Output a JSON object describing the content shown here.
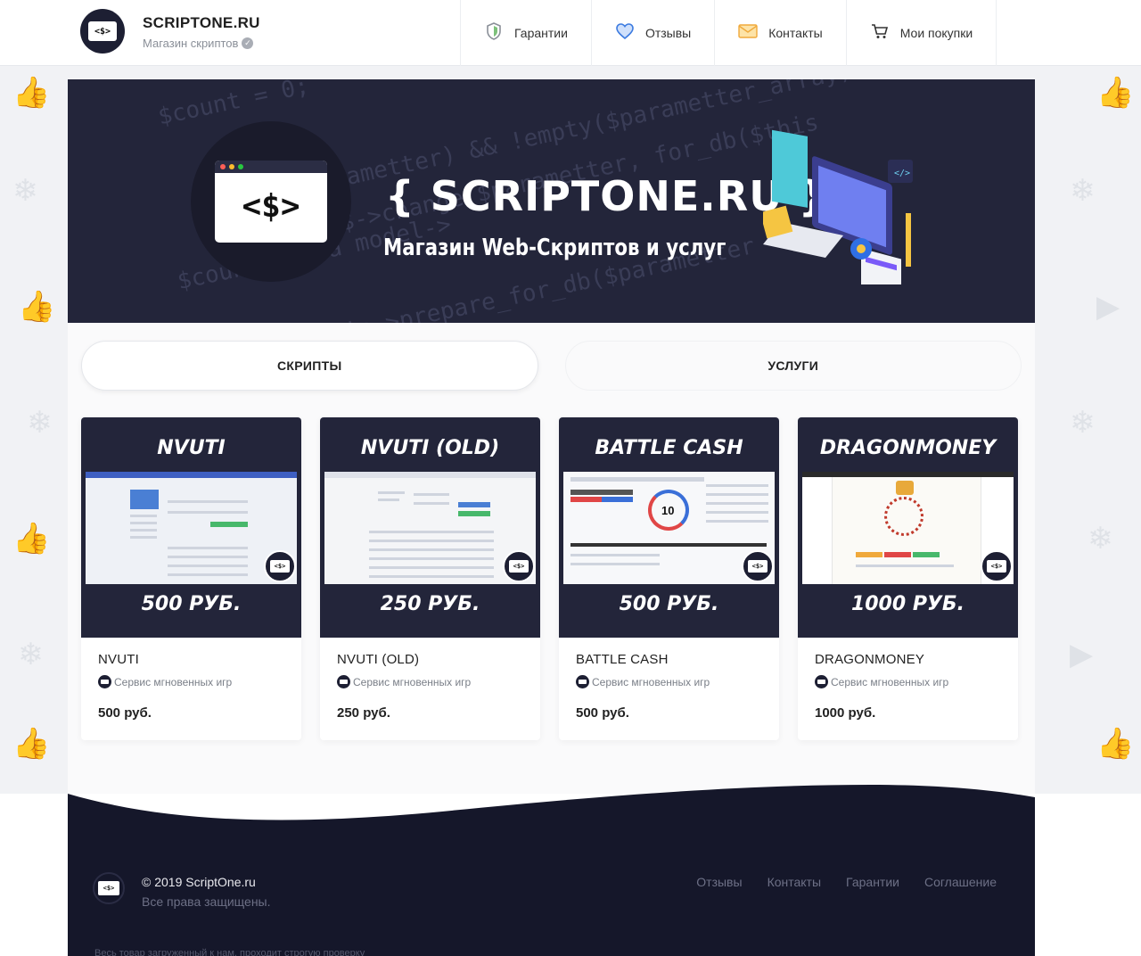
{
  "header": {
    "brand_title": "SCRIPTONE.RU",
    "brand_subtitle": "Магазин скриптов",
    "logo_text": "<$>",
    "nav": [
      {
        "label": "Гарантии",
        "icon": "shield-icon"
      },
      {
        "label": "Отзывы",
        "icon": "heart-icon"
      },
      {
        "label": "Контакты",
        "icon": "envelope-icon"
      },
      {
        "label": "Мои покупки",
        "icon": "cart-icon"
      }
    ]
  },
  "banner": {
    "logo_text": "<$>",
    "title": "{ SCRIPTONE.RU }",
    "subtitle": "Магазин Web-Скриптов и услуг"
  },
  "tabs": [
    {
      "label": "СКРИПТЫ",
      "active": true
    },
    {
      "label": "УСЛУГИ",
      "active": false
    }
  ],
  "products": [
    {
      "image_title": "NVUTI",
      "image_price": "500 РУБ.",
      "name": "NVUTI",
      "category": "Сервис мгновенных игр",
      "price": "500 руб."
    },
    {
      "image_title": "NVUTI (OLD)",
      "image_price": "250 РУБ.",
      "name": "NVUTI (OLD)",
      "category": "Сервис мгновенных игр",
      "price": "250 руб."
    },
    {
      "image_title": "BATTLE CASH",
      "image_price": "500 РУБ.",
      "name": "BATTLE CASH",
      "category": "Сервис мгновенных игр",
      "price": "500 руб."
    },
    {
      "image_title": "DRAGONMONEY",
      "image_price": "1000 РУБ.",
      "name": "DRAGONMONEY",
      "category": "Сервис мгновенных игр",
      "price": "1000 руб."
    }
  ],
  "footer": {
    "logo_text": "<$>",
    "copyright": "© 2019 ScriptOne.ru",
    "rights": "Все права защищены.",
    "links": [
      "Отзывы",
      "Контакты",
      "Гарантии",
      "Соглашение"
    ],
    "note": "Весь товар загруженный к нам, проходит строгую проверку"
  },
  "colors": {
    "dark": "#23253a",
    "footer_dark": "#15172a",
    "accent_blue": "#3c7be0"
  }
}
